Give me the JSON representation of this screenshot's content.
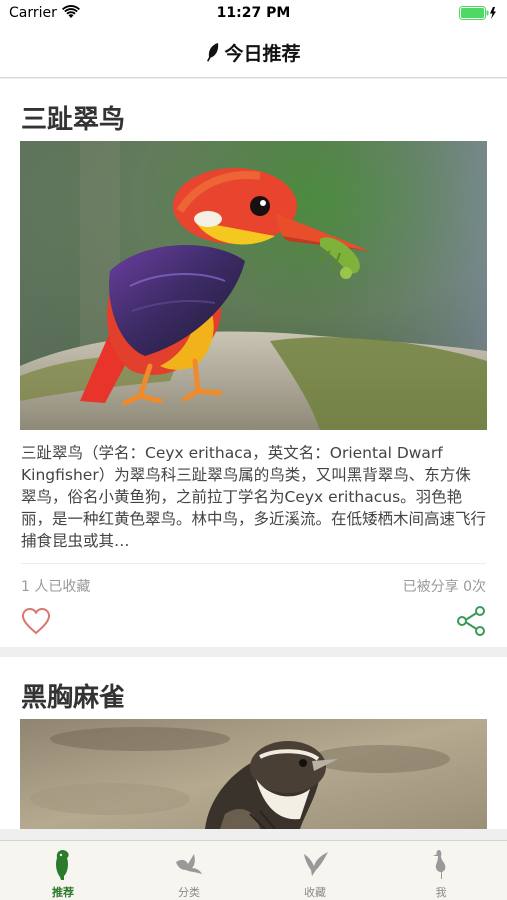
{
  "status_bar": {
    "carrier": "Carrier",
    "time": "11:27 PM"
  },
  "nav": {
    "title": "今日推荐",
    "icon": "feather-icon"
  },
  "feed": [
    {
      "title": "三趾翠鸟",
      "description": "三趾翠鸟（学名：Ceyx erithaca，英文名：Oriental Dwarf Kingfisher）为翠鸟科三趾翠鸟属的鸟类，又叫黑背翠鸟、东方侏翠鸟，俗名小黄鱼狗，之前拉丁学名为Ceyx erithacus。羽色艳丽，是一种红黄色翠鸟。林中鸟，多近溪流。在低矮栖木间高速飞行捕食昆虫或其…",
      "favorites": "1 人已收藏",
      "shares": "已被分享 0次"
    },
    {
      "title": "黑胸麻雀"
    }
  ],
  "tabs": [
    {
      "label": "推荐",
      "icon": "recommend-bird-icon",
      "active": true
    },
    {
      "label": "分类",
      "icon": "category-bird-icon",
      "active": false
    },
    {
      "label": "收藏",
      "icon": "favorite-bird-icon",
      "active": false
    },
    {
      "label": "我",
      "icon": "heron-profile-icon",
      "active": false
    }
  ],
  "colors": {
    "accent_green": "#2c7a2c",
    "heart_red": "#d9776d",
    "share_green": "#3a9a55"
  }
}
